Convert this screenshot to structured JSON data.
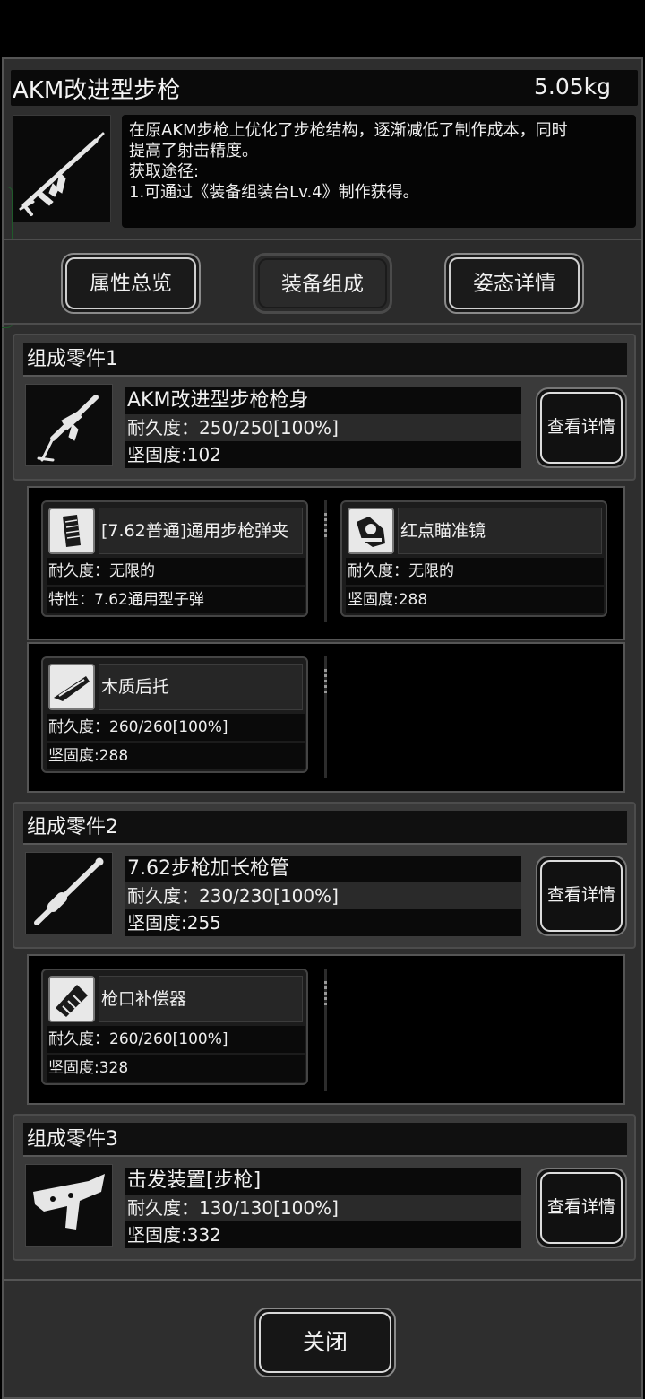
{
  "header": {
    "title": "AKM改进型步枪",
    "weight": "5.05kg"
  },
  "description": {
    "lines": [
      "在原AKM步枪上优化了步枪结构，逐渐减低了制作成本，同时",
      "提高了射击精度。",
      "获取途径:",
      "1.可通过《装备组装台Lv.4》制作获得。"
    ]
  },
  "tabs": [
    "属性总览",
    "装备组成",
    "姿态详情"
  ],
  "parts": [
    {
      "title": "组成零件1",
      "name": "AKM改进型步枪枪身",
      "durability": "耐久度：250/250[100%]",
      "hardness": "坚固度:102",
      "detail_label": "查看详情",
      "subparts": [
        {
          "name": "[7.62普通]通用步枪弹夹",
          "row1": "耐久度：无限的",
          "row2": "特性：7.62通用型子弹",
          "icon": "magazine-icon"
        },
        {
          "name": "红点瞄准镜",
          "row1": "耐久度：无限的",
          "row2": "坚固度:288",
          "icon": "red-dot-sight-icon"
        },
        {
          "name": "木质后托",
          "row1": "耐久度：260/260[100%]",
          "row2": "坚固度:288",
          "icon": "wooden-stock-icon"
        }
      ]
    },
    {
      "title": "组成零件2",
      "name": "7.62步枪加长枪管",
      "durability": "耐久度：230/230[100%]",
      "hardness": "坚固度:255",
      "detail_label": "查看详情",
      "subparts": [
        {
          "name": "枪口补偿器",
          "row1": "耐久度：260/260[100%]",
          "row2": "坚固度:328",
          "icon": "muzzle-compensator-icon"
        }
      ]
    },
    {
      "title": "组成零件3",
      "name": "击发装置[步枪]",
      "durability": "耐久度：130/130[100%]",
      "hardness": "坚固度:332",
      "detail_label": "查看详情"
    }
  ],
  "footer": {
    "close_label": "关闭"
  }
}
